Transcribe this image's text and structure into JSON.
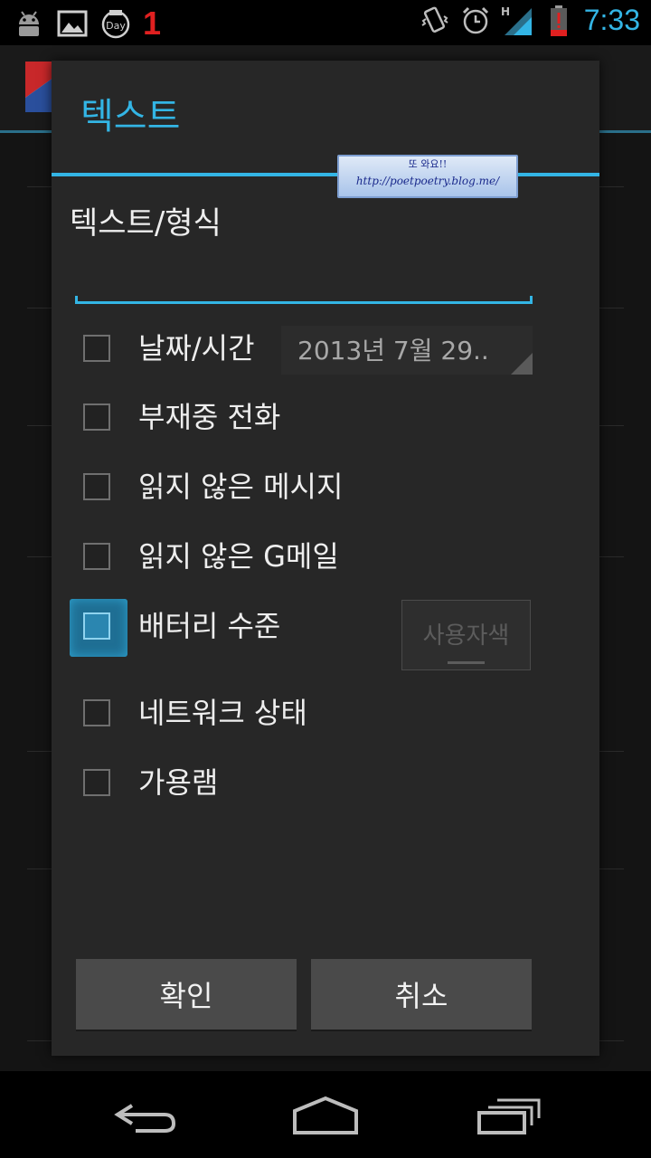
{
  "status_bar": {
    "notification_count": "1",
    "time": "7:33",
    "left_icons": [
      "android-debug-icon",
      "image-icon",
      "calendar-day-icon"
    ],
    "right_icons": [
      "vibrate-icon",
      "alarm-icon",
      "signal-h-icon",
      "battery-low-icon"
    ]
  },
  "dialog": {
    "title": "텍스트",
    "watermark_line1": "또 와요!!",
    "watermark_line2": "http://poetpoetry.blog.me/",
    "section_label": "텍스트/형식",
    "text_input_value": "",
    "options": [
      {
        "label": "날짜/시간",
        "checked": false
      },
      {
        "label": "부재중 전화",
        "checked": false
      },
      {
        "label": "읽지 않은 메시지",
        "checked": false
      },
      {
        "label": "읽지 않은 G메일",
        "checked": false
      },
      {
        "label": "배터리 수준",
        "checked": false
      },
      {
        "label": "네트워크 상태",
        "checked": false
      },
      {
        "label": "가용램",
        "checked": false
      }
    ],
    "date_spinner_value": "2013년 7월 29..",
    "color_button_label": "사용자색",
    "ok_button": "확인",
    "cancel_button": "취소"
  },
  "colors": {
    "accent": "#33b5e5",
    "dialog_bg": "#272727",
    "button_bg": "#4a4a4a",
    "notification_red": "#e02020"
  }
}
